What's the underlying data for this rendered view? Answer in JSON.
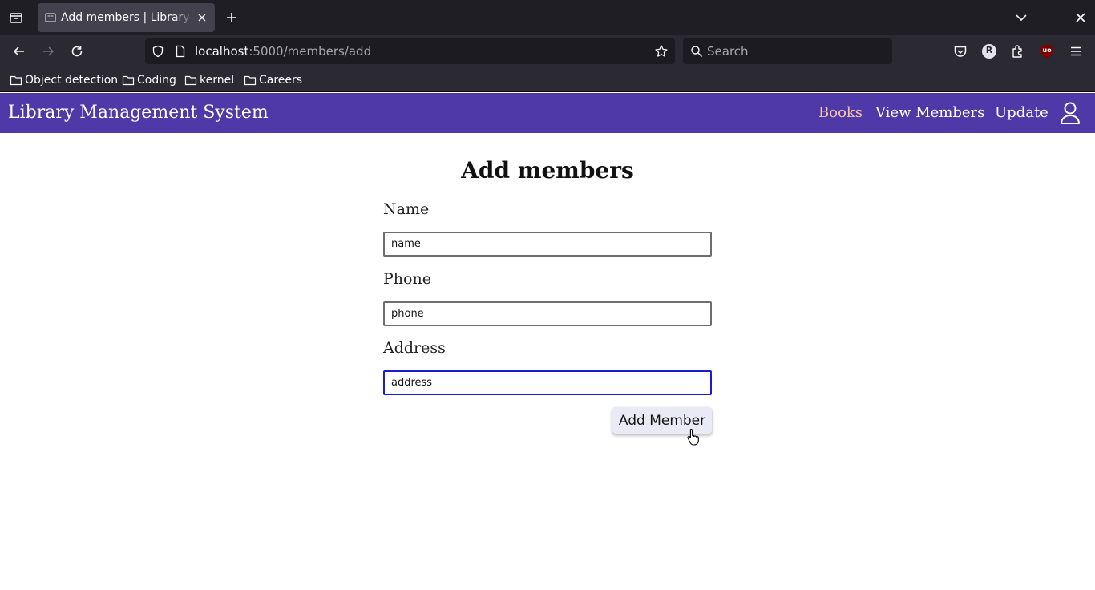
{
  "browser": {
    "tab": {
      "title": "Add members | Library Management System"
    },
    "url": {
      "host": "localhost",
      "path": ":5000/members/add"
    },
    "search_placeholder": "Search",
    "bookmarks": [
      "Object detection",
      "Coding",
      "kernel",
      "Careers"
    ],
    "profile_initial": "R",
    "extension_badge": "uo"
  },
  "app": {
    "brand": "Library Management System",
    "nav": {
      "books": "Books",
      "view_members": "View Members",
      "update": "Update"
    }
  },
  "form": {
    "heading": "Add members",
    "name": {
      "label": "Name",
      "value": "name"
    },
    "phone": {
      "label": "Phone",
      "value": "phone"
    },
    "address": {
      "label": "Address",
      "value": "address"
    },
    "submit_label": "Add Member"
  },
  "colors": {
    "navbar": "#4f38a8",
    "active_link": "#f5c6a5",
    "focus_border": "#1a1ad6"
  }
}
